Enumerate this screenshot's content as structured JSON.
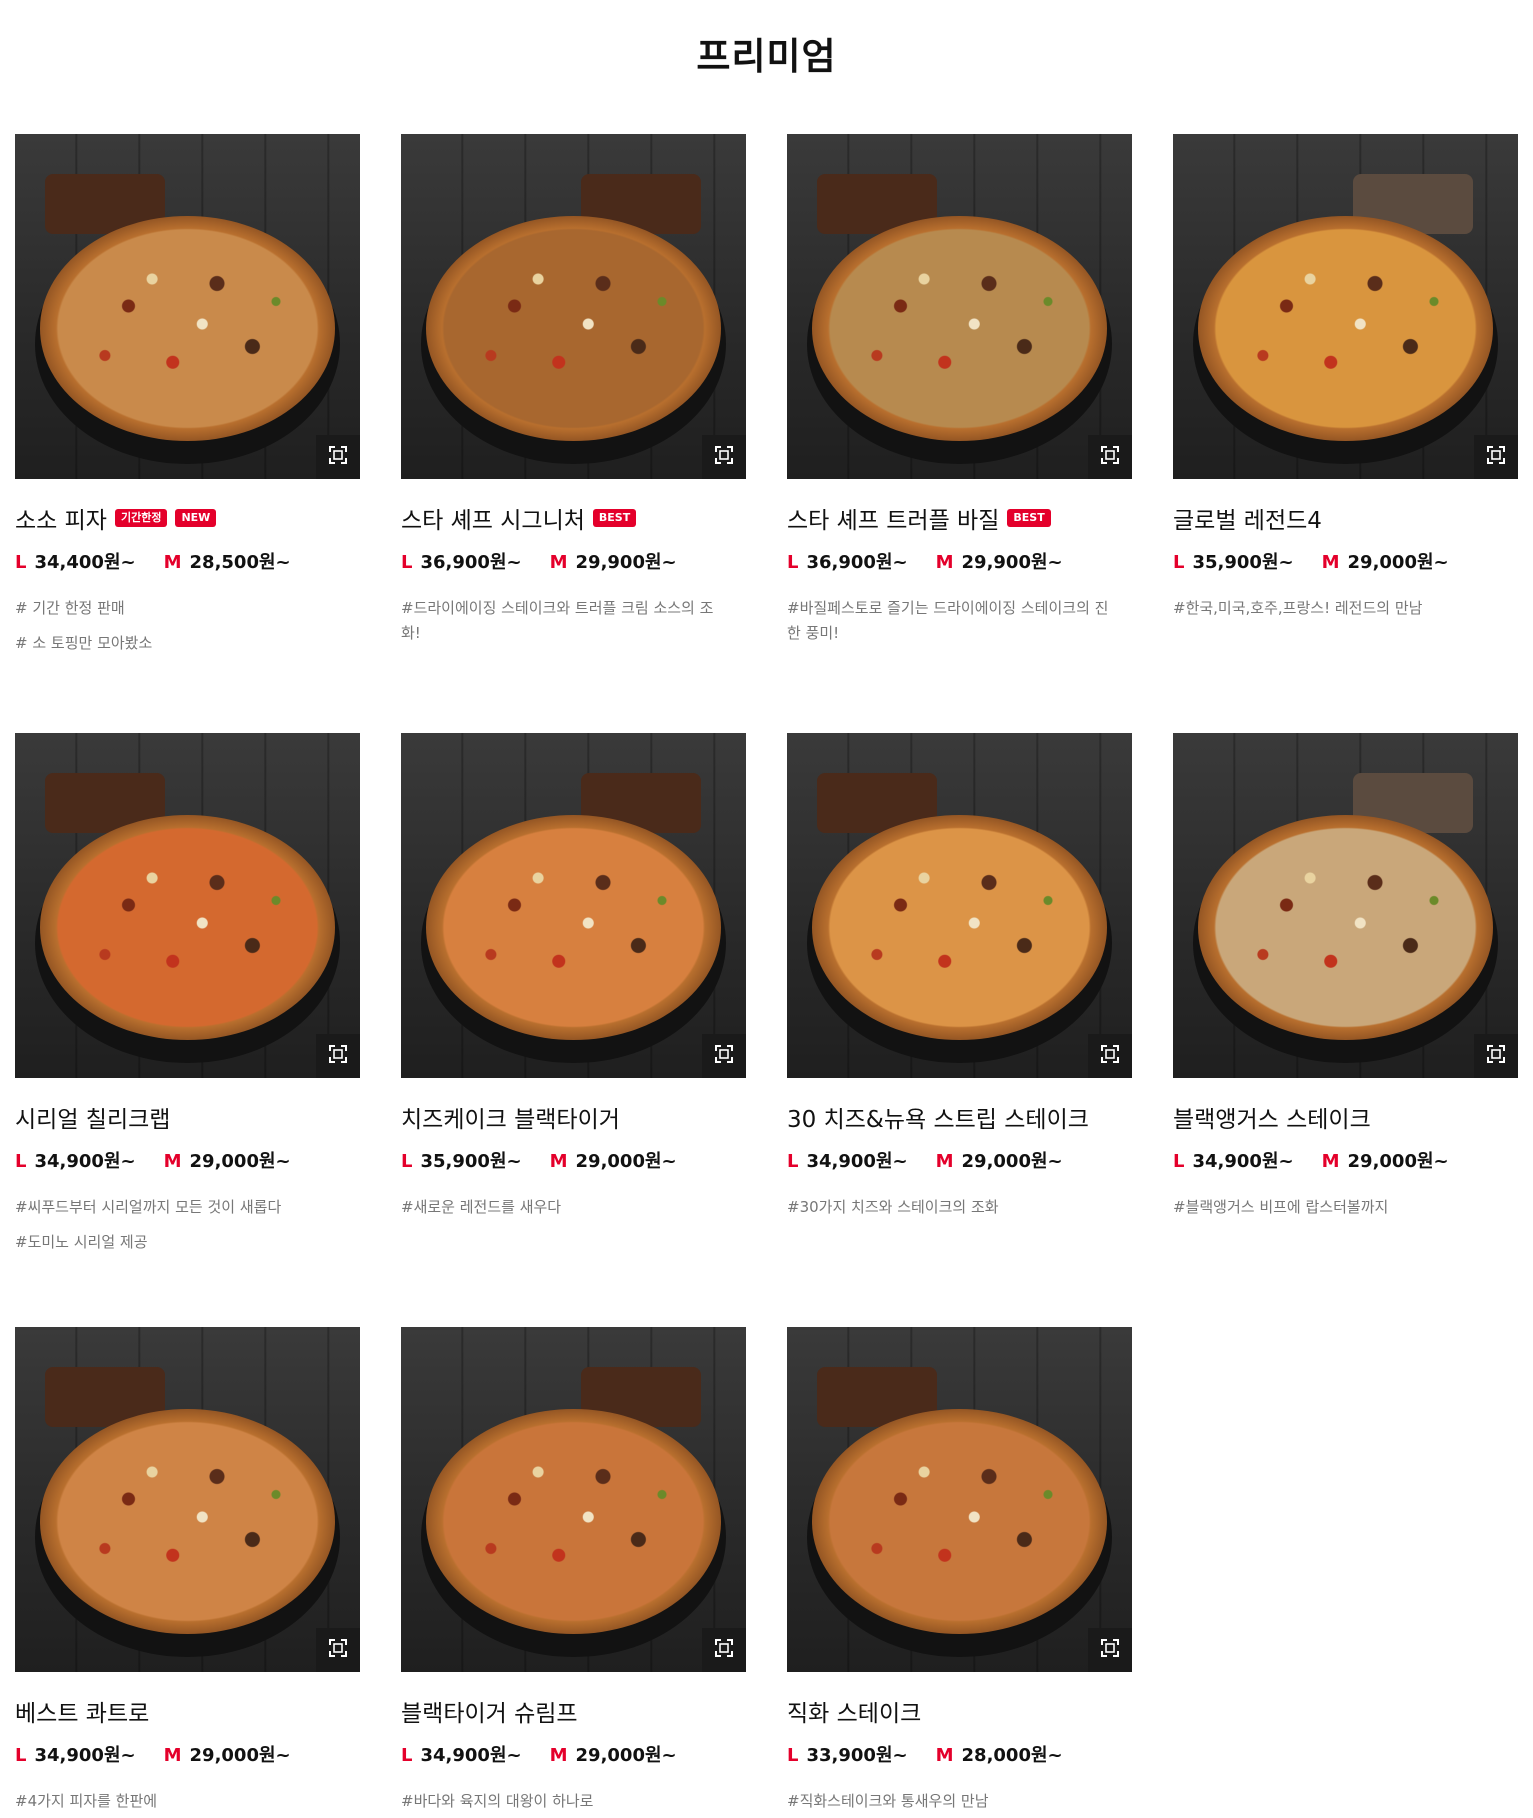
{
  "page": {
    "title": "프리미엄"
  },
  "products": [
    {
      "name": "소소 피자",
      "badges": [
        "기간한정",
        "NEW"
      ],
      "price_l": "34,400원~",
      "price_m": "28,500원~",
      "tags": [
        "# 기간 한정 판매",
        "# 소 토핑만 모아봤소"
      ],
      "pizza_color": "#c98a4b"
    },
    {
      "name": "스타 셰프 시그니처",
      "badges": [
        "BEST"
      ],
      "price_l": "36,900원~",
      "price_m": "29,900원~",
      "tags": [
        "#드라이에이징 스테이크와 트러플 크림 소스의 조화!"
      ],
      "pizza_color": "#a8672f"
    },
    {
      "name": "스타 셰프 트러플 바질",
      "badges": [
        "BEST"
      ],
      "price_l": "36,900원~",
      "price_m": "29,900원~",
      "tags": [
        "#바질페스토로 즐기는 드라이에이징 스테이크의 진한 풍미!"
      ],
      "pizza_color": "#b78a4f"
    },
    {
      "name": "글로벌 레전드4",
      "badges": [],
      "price_l": "35,900원~",
      "price_m": "29,000원~",
      "tags": [
        "#한국,미국,호주,프랑스! 레전드의 만남"
      ],
      "pizza_color": "#d9953e"
    },
    {
      "name": "시리얼 칠리크랩",
      "badges": [],
      "price_l": "34,900원~",
      "price_m": "29,000원~",
      "tags": [
        "#씨푸드부터 시리얼까지 모든 것이 새롭다",
        "#도미노 시리얼 제공"
      ],
      "pizza_color": "#d4692f"
    },
    {
      "name": "치즈케이크 블랙타이거",
      "badges": [],
      "price_l": "35,900원~",
      "price_m": "29,000원~",
      "tags": [
        "#새로운 레전드를 새우다"
      ],
      "pizza_color": "#d7803f"
    },
    {
      "name": "30 치즈&뉴욕 스트립 스테이크",
      "badges": [],
      "price_l": "34,900원~",
      "price_m": "29,000원~",
      "tags": [
        "#30가지 치즈와 스테이크의 조화"
      ],
      "pizza_color": "#dc9447"
    },
    {
      "name": "블랙앵거스 스테이크",
      "badges": [],
      "price_l": "34,900원~",
      "price_m": "29,000원~",
      "tags": [
        "#블랙앵거스 비프에 랍스터볼까지"
      ],
      "pizza_color": "#c9a77a"
    },
    {
      "name": "베스트 콰트로",
      "badges": [],
      "price_l": "34,900원~",
      "price_m": "29,000원~",
      "tags": [
        "#4가지 피자를 한판에"
      ],
      "pizza_color": "#cf8446"
    },
    {
      "name": "블랙타이거 슈림프",
      "badges": [],
      "price_l": "34,900원~",
      "price_m": "29,000원~",
      "tags": [
        "#바다와 육지의 대왕이 하나로"
      ],
      "pizza_color": "#c9753a"
    },
    {
      "name": "직화 스테이크",
      "badges": [],
      "price_l": "33,900원~",
      "price_m": "28,000원~",
      "tags": [
        "#직화스테이크와 통새우의 만남"
      ],
      "pizza_color": "#c7773c"
    }
  ],
  "labels": {
    "size_l": "L",
    "size_m": "M"
  },
  "colors": {
    "accent": "#e4002b",
    "text": "#111111",
    "tag_text": "#777777"
  },
  "icons": {
    "zoom": "expand-icon"
  }
}
